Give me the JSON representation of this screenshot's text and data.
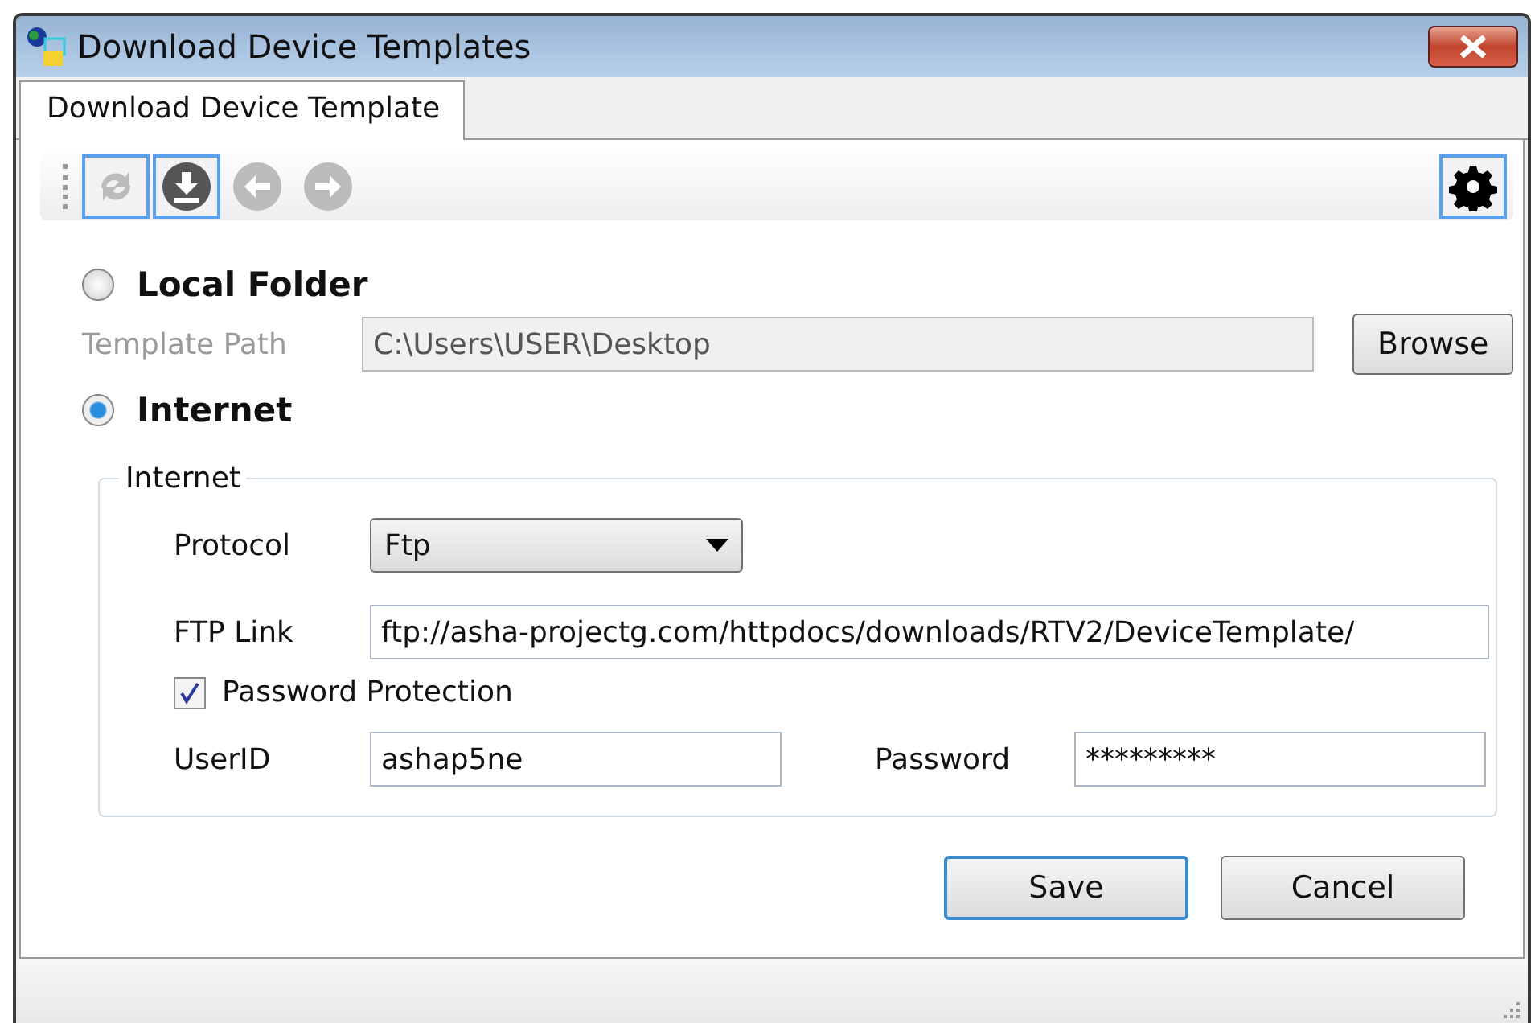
{
  "window": {
    "title": "Download Device Templates"
  },
  "tabs": [
    {
      "label": "Download Device Template",
      "selected": true
    }
  ],
  "toolbar": {
    "items": [
      {
        "kind": "refresh",
        "disabled": true,
        "highlighted": true
      },
      {
        "kind": "download",
        "disabled": false,
        "highlighted": true
      },
      {
        "kind": "back",
        "disabled": true,
        "highlighted": false
      },
      {
        "kind": "forward",
        "disabled": true,
        "highlighted": false
      }
    ],
    "settings": {
      "highlighted": true
    }
  },
  "sources": [
    {
      "label": "Local Folder",
      "selected": false
    },
    {
      "label": "Internet",
      "selected": true
    }
  ],
  "local": {
    "label": "Template Path",
    "value": "C:\\Users\\USER\\Desktop",
    "disabled": true,
    "button": "Browse"
  },
  "internet": {
    "title": "Internet",
    "protocol": {
      "label": "Protocol",
      "value": "Ftp"
    },
    "link": {
      "label": "FTP Link",
      "value": "ftp://asha-projectg.com/httpdocs/downloads/RTV2/DeviceTemplate/"
    },
    "protection": {
      "label": "Password Protection",
      "checked": true
    },
    "user": {
      "label": "UserID",
      "value": "ashap5ne"
    },
    "password": {
      "label": "Password",
      "value": "*********"
    }
  },
  "buttons": [
    {
      "label": "Save",
      "default": true
    },
    {
      "label": "Cancel",
      "default": false
    }
  ]
}
